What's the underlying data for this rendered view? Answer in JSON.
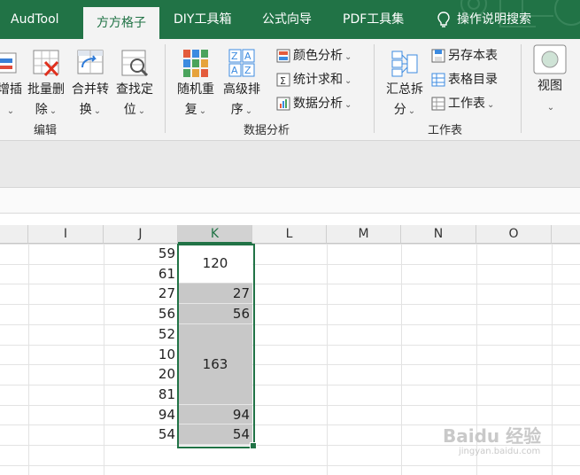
{
  "tabs": [
    {
      "label": "AudTool",
      "active": false
    },
    {
      "label": "方方格子",
      "active": true
    },
    {
      "label": "DIY工具箱",
      "active": false
    },
    {
      "label": "公式向导",
      "active": false
    },
    {
      "label": "PDF工具集",
      "active": false
    }
  ],
  "help_search": {
    "icon": "lightbulb-icon",
    "label": "操作说明搜索"
  },
  "groups": {
    "edit": {
      "label": "编辑",
      "buttons": [
        {
          "line1": "增插",
          "line2": "",
          "icon": "insert-icon"
        },
        {
          "line1": "批量删",
          "line2": "除",
          "icon": "batch-delete-icon"
        },
        {
          "line1": "合并转",
          "line2": "换",
          "icon": "merge-convert-icon"
        },
        {
          "line1": "查找定",
          "line2": "位",
          "icon": "find-locate-icon"
        }
      ]
    },
    "data_analysis": {
      "label": "数据分析",
      "buttons": [
        {
          "line1": "随机重",
          "line2": "复",
          "icon": "random-repeat-icon"
        },
        {
          "line1": "高级排",
          "line2": "序",
          "icon": "advanced-sort-icon"
        }
      ],
      "small_buttons": [
        {
          "label": "颜色分析",
          "icon": "color-analysis-icon"
        },
        {
          "label": "统计求和",
          "icon": "statistics-sum-icon"
        },
        {
          "label": "数据分析",
          "icon": "data-analysis-icon"
        }
      ]
    },
    "worksheet": {
      "label": "工作表",
      "buttons": [
        {
          "line1": "汇总拆",
          "line2": "分",
          "icon": "summary-split-icon"
        }
      ],
      "small_buttons": [
        {
          "label": "另存本表",
          "icon": "save-sheet-icon"
        },
        {
          "label": "表格目录",
          "icon": "table-directory-icon"
        },
        {
          "label": "工作表",
          "icon": "worksheet-icon"
        }
      ]
    },
    "view": {
      "label": "视图",
      "icon": "view-icon"
    }
  },
  "columns": [
    "I",
    "J",
    "K",
    "L",
    "M",
    "N",
    "O"
  ],
  "selected_column": "K",
  "column_j_values": [
    "59",
    "61",
    "27",
    "56",
    "52",
    "10",
    "20",
    "81",
    "94",
    "54"
  ],
  "column_k_cells": [
    {
      "value": "120",
      "merged_rows": 2,
      "grey": false,
      "align": "center"
    },
    {
      "value": "27",
      "merged_rows": 1,
      "grey": true,
      "align": "right"
    },
    {
      "value": "56",
      "merged_rows": 1,
      "grey": true,
      "align": "right"
    },
    {
      "value": "163",
      "merged_rows": 4,
      "grey": true,
      "align": "center"
    },
    {
      "value": "94",
      "merged_rows": 1,
      "grey": true,
      "align": "right"
    },
    {
      "value": "54",
      "merged_rows": 1,
      "grey": true,
      "align": "right"
    }
  ],
  "watermark": {
    "text": "Baidu 经验",
    "subtext": "jingyan.baidu.com"
  },
  "colors": {
    "brand": "#217346",
    "selection_fill": "#c8c8c8",
    "header_selected": "#d2d2d2"
  }
}
